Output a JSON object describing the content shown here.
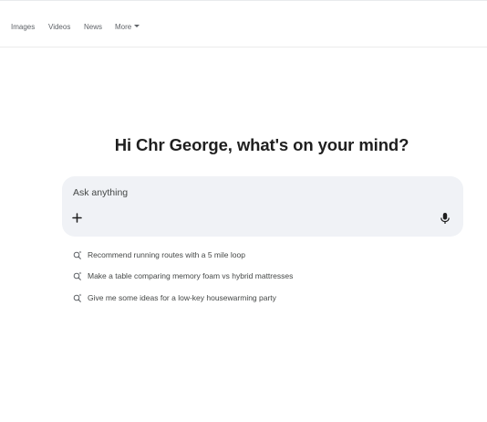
{
  "tabs": [
    {
      "label": "Images"
    },
    {
      "label": "Videos"
    },
    {
      "label": "News"
    },
    {
      "label": "More"
    }
  ],
  "greeting": "Hi Chr George, what's on your mind?",
  "search": {
    "placeholder": "Ask anything",
    "value": "",
    "add_icon": "plus-icon",
    "voice_icon": "microphone-icon"
  },
  "suggestions": [
    {
      "icon": "search-sparkle-icon",
      "text": "Recommend running routes with a 5 mile loop"
    },
    {
      "icon": "search-sparkle-icon",
      "text": "Make a table comparing memory foam vs hybrid mattresses"
    },
    {
      "icon": "search-sparkle-icon",
      "text": "Give me some ideas for a low-key housewarming party"
    }
  ],
  "colors": {
    "box_background": "#f0f2f6",
    "text_primary": "#1f1f1f",
    "text_secondary": "#5f6368"
  }
}
